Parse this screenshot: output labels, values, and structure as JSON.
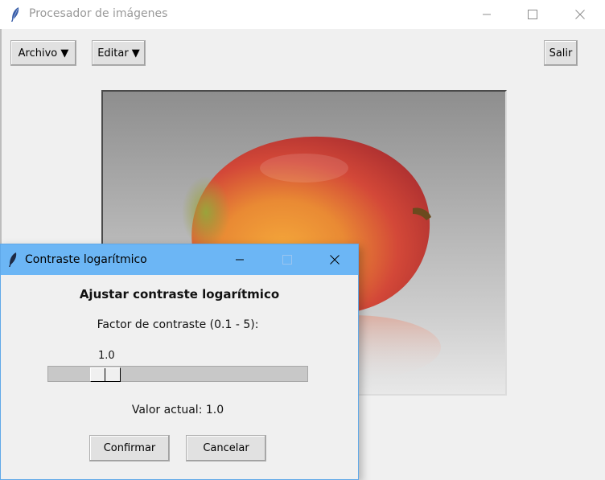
{
  "window": {
    "title": "Procesador de imágenes",
    "controls": {
      "minimize": "minimize-icon",
      "maximize": "maximize-icon",
      "close": "close-icon"
    }
  },
  "toolbar": {
    "archivo_label": "Archivo ▼",
    "editar_label": "Editar ▼",
    "salir_label": "Salir"
  },
  "image": {
    "subject": "mango-photo-icon"
  },
  "dialog": {
    "title": "Contraste logarítmico",
    "heading": "Ajustar contraste logarítmico",
    "factor_label": "Factor de contraste (0.1 - 5):",
    "slider": {
      "value": "1.0",
      "min": 0.1,
      "max": 5,
      "current": 1.0
    },
    "current_value_text": "Valor actual: 1.0",
    "confirm_label": "Confirmar",
    "cancel_label": "Cancelar"
  },
  "colors": {
    "dialog_titlebar": "#6cb6f5",
    "background": "#f0f0f0"
  }
}
